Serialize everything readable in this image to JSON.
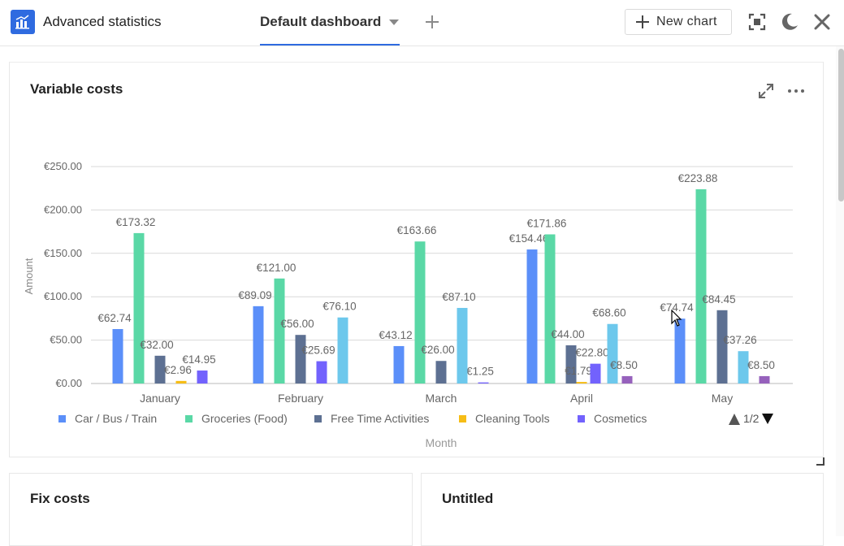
{
  "app": {
    "title": "Advanced statistics",
    "logo_icon": "bar-chart-icon",
    "accent": "#2f6be0"
  },
  "tabs": [
    {
      "label": "Default dashboard",
      "active": true
    }
  ],
  "toolbar": {
    "add_tab_icon": "plus-icon",
    "new_chart_label": "New chart",
    "new_chart_icon": "plus-icon",
    "fullscreen_icon": "focus-icon",
    "dark_mode_icon": "moon-icon",
    "close_icon": "close-icon"
  },
  "cards": {
    "main": {
      "title": "Variable costs",
      "expand_icon": "expand-icon",
      "more_icon": "more-icon"
    },
    "fix": {
      "title": "Fix costs"
    },
    "untitled": {
      "title": "Untitled"
    }
  },
  "chart_data": {
    "type": "bar",
    "title": "Variable costs",
    "xlabel": "Month",
    "ylabel": "Amount",
    "ylim": [
      0,
      250
    ],
    "yticks": [
      "€0.00",
      "€50.00",
      "€100.00",
      "€150.00",
      "€200.00",
      "€250.00"
    ],
    "ytick_values": [
      0,
      50,
      100,
      150,
      200,
      250
    ],
    "grid": true,
    "legend_position": "bottom",
    "legend_pager": "1/2",
    "categories": [
      "January",
      "February",
      "March",
      "April",
      "May"
    ],
    "series": [
      {
        "name": "Car / Bus / Train",
        "color": "#5b8ff9",
        "values": [
          62.74,
          89.09,
          43.12,
          154.46,
          74.74
        ],
        "labels": [
          "€62.74",
          "€89.09",
          "€43.12",
          "€154.46",
          "€74.74"
        ]
      },
      {
        "name": "Groceries (Food)",
        "color": "#5ad8a6",
        "values": [
          173.32,
          121.0,
          163.66,
          171.86,
          223.88
        ],
        "labels": [
          "€173.32",
          "€121.00",
          "€163.66",
          "€171.86",
          "€223.88"
        ]
      },
      {
        "name": "Free Time Activities",
        "color": "#5d7092",
        "values": [
          32.0,
          56.0,
          26.0,
          44.0,
          84.45
        ],
        "labels": [
          "€32.00",
          "€56.00",
          "€26.00",
          "€44.00",
          "€84.45"
        ]
      },
      {
        "name": "Cleaning Tools",
        "color": "#f6bd16",
        "values": [
          2.96,
          null,
          null,
          1.79,
          null
        ],
        "labels": [
          "€2.96",
          "",
          "",
          "€1.79",
          ""
        ]
      },
      {
        "name": "Cosmetics",
        "color": "#7262fd",
        "values": [
          14.95,
          25.69,
          1.25,
          22.8,
          null
        ],
        "labels": [
          "€14.95",
          "€25.69",
          "€1.25",
          "€22.80",
          ""
        ]
      },
      {
        "name": "",
        "color": "#6dc8ec",
        "values": [
          null,
          76.1,
          87.1,
          68.6,
          37.26
        ],
        "labels": [
          "",
          "€76.10",
          "€87.10",
          "€68.60",
          "€37.26"
        ]
      },
      {
        "name": "",
        "color": "#9661bc",
        "values": [
          null,
          null,
          null,
          8.5,
          8.5
        ],
        "labels": [
          "",
          "",
          "",
          "€8.50",
          "€8.50"
        ]
      }
    ]
  }
}
